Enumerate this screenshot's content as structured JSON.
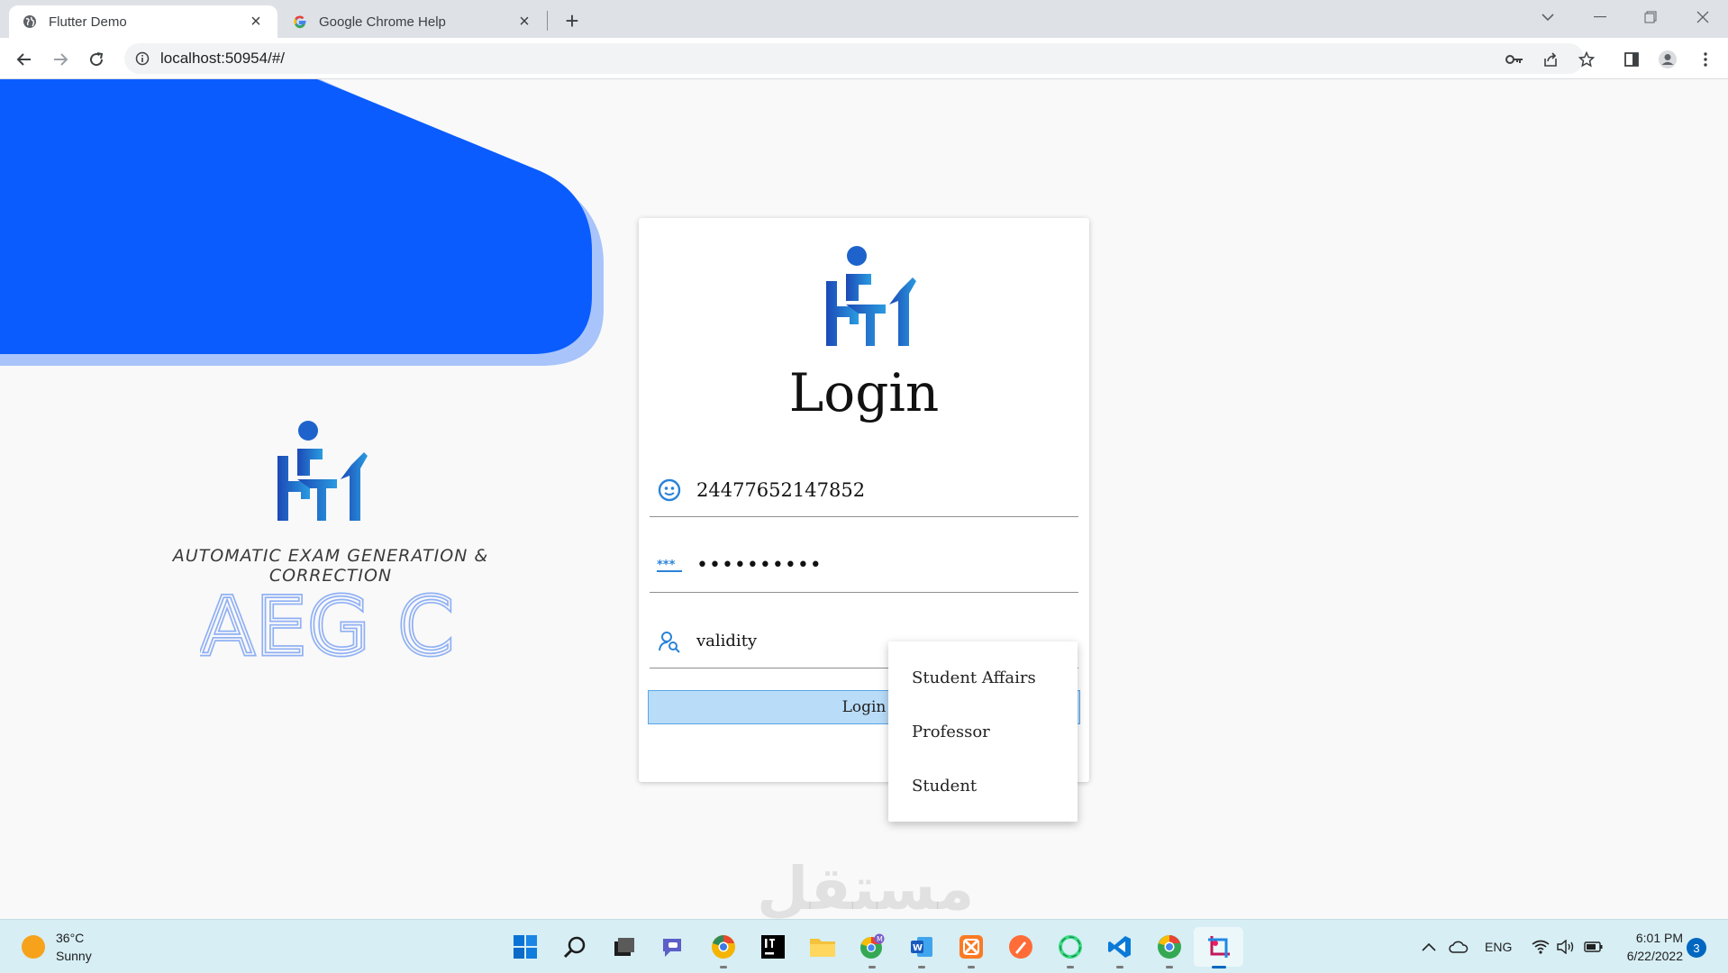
{
  "browser": {
    "tabs": [
      {
        "title": "Flutter Demo",
        "icon": "globe-icon",
        "active": true
      },
      {
        "title": "Google Chrome Help",
        "icon": "google-g-icon",
        "active": false
      }
    ],
    "close_glyph": "×",
    "new_tab_glyph": "+",
    "url": "localhost:50954/#/"
  },
  "app": {
    "tagline": "AUTOMATIC EXAM GENERATION & CORRECTION",
    "acronym": "AEG C",
    "brand_color": "#0a5cff",
    "card": {
      "title": "Login",
      "id_value": "24477652147852",
      "password_mask": "••••••••••",
      "role_value": "validity",
      "login_button": "Login"
    },
    "role_options": [
      "Student Affairs",
      "Professor",
      "Student"
    ]
  },
  "watermark": "مستقل",
  "taskbar": {
    "weather": {
      "temp": "36°C",
      "condition": "Sunny"
    },
    "apps": [
      "start-icon",
      "search-icon",
      "task-view-icon",
      "teams-chat-icon",
      "chrome-canary-icon",
      "intellij-icon",
      "file-explorer-icon",
      "chrome-profile-icon",
      "word-icon",
      "xampp-icon",
      "postman-icon",
      "android-studio-icon",
      "vscode-icon",
      "chrome-icon",
      "snipping-tool-icon"
    ],
    "language": "ENG",
    "time": "6:01 PM",
    "date": "6/22/2022",
    "notifications": "3"
  }
}
